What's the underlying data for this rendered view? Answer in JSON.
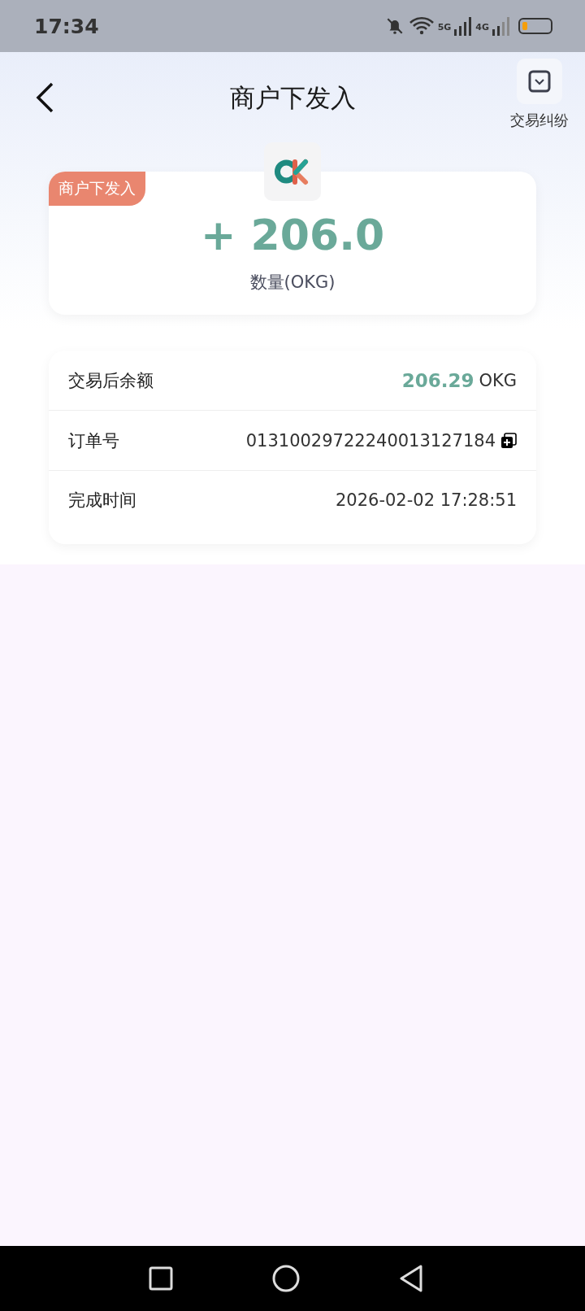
{
  "status_bar": {
    "time": "17:34",
    "network_1": "5G",
    "network_2": "4G"
  },
  "header": {
    "title": "商户下发入",
    "action_label": "交易纠纷"
  },
  "summary": {
    "badge": "商户下发入",
    "amount": "+ 206.0",
    "unit_label": "数量(OKG)"
  },
  "details": [
    {
      "kind": "balance",
      "label": "交易后余额",
      "value": "206.29",
      "unit": "OKG"
    },
    {
      "kind": "copyable",
      "label": "订单号",
      "value": "01310029722240013127184"
    },
    {
      "kind": "plain",
      "label": "完成时间",
      "value": "2026-02-02 17:28:51"
    }
  ]
}
